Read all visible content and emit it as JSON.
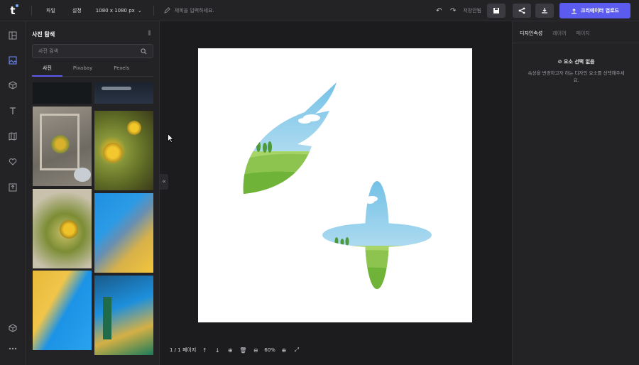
{
  "header": {
    "menu": [
      "파일",
      "설정"
    ],
    "size_label": "1080 x 1080 px",
    "title_placeholder": "제목을 입력하세요.",
    "save_status": "저장안됨",
    "upload_label": "크리에이터 업로드"
  },
  "left_rail": {
    "icons": [
      "layout-icon",
      "image-icon",
      "cube-icon",
      "text-icon",
      "map-icon",
      "heart-icon",
      "upload-icon",
      "package-icon",
      "more-icon"
    ]
  },
  "panel": {
    "title": "사진 탐색",
    "search_placeholder": "사진 검색",
    "tabs": [
      "사진",
      "Pixabay",
      "Pexels"
    ],
    "active_tab": "사진"
  },
  "canvas": {
    "page_info": "1 / 1 페이지",
    "zoom": "60%"
  },
  "right_panel": {
    "tabs": [
      "디자인속성",
      "레이어",
      "페이지"
    ],
    "active_tab": "디자인속성",
    "no_selection_title": "요소 선택 없음",
    "no_selection_desc": "속성을 변경하고자 하는 디자인 요소를 선택해주세요."
  },
  "colors": {
    "accent": "#5b5bf0",
    "background": "#1c1c1f",
    "panel": "#232326"
  }
}
